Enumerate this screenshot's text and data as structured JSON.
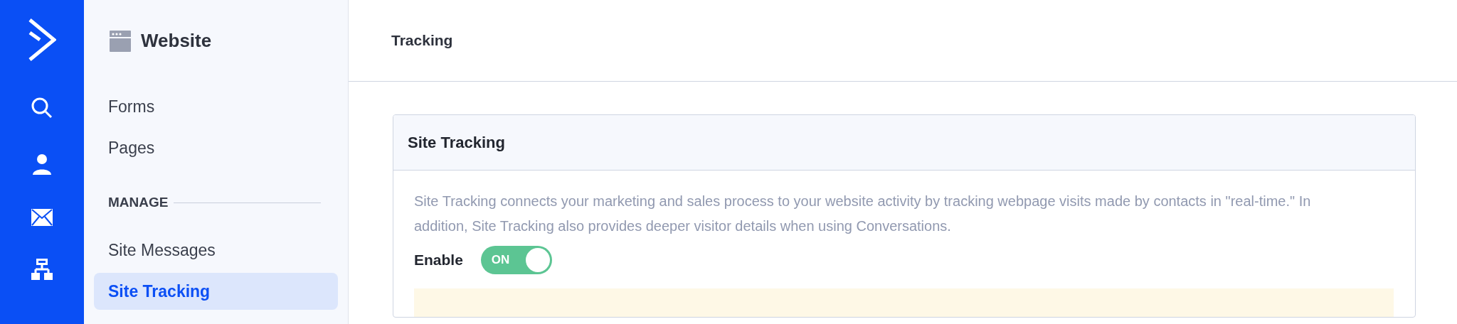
{
  "sidebar": {
    "title": "Website",
    "items": [
      {
        "label": "Forms",
        "selected": false
      },
      {
        "label": "Pages",
        "selected": false
      }
    ],
    "section": "MANAGE",
    "section_items": [
      {
        "label": "Site Messages",
        "selected": false
      },
      {
        "label": "Site Tracking",
        "selected": true
      }
    ]
  },
  "header": {
    "title": "Tracking"
  },
  "card": {
    "title": "Site Tracking",
    "description": "Site Tracking connects your marketing and sales process to your website activity by tracking webpage visits made by contacts in \"real-time.\" In addition, Site Tracking also provides deeper visitor details when using Conversations.",
    "enable_label": "Enable",
    "toggle": {
      "on": true,
      "label": "ON"
    }
  }
}
